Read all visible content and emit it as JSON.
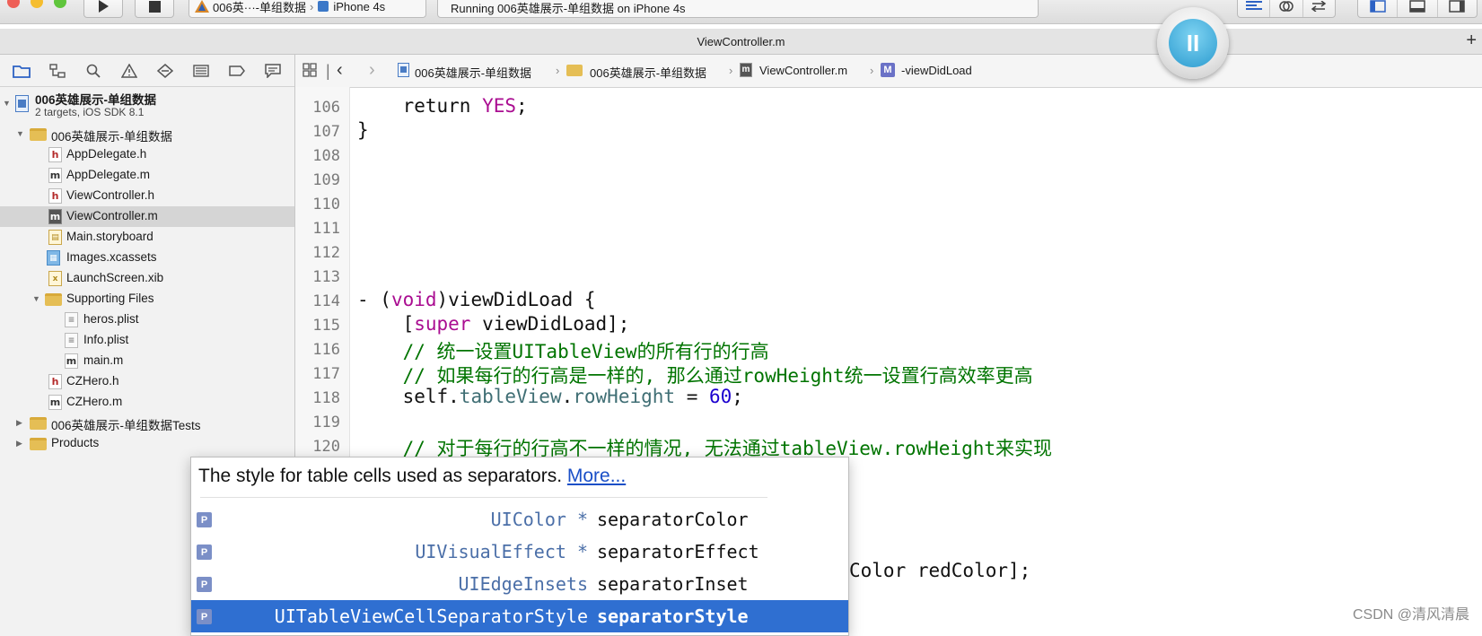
{
  "toolbar": {
    "run_icon": "play-icon",
    "stop_icon": "stop-icon",
    "scheme": "006英···-单组数据",
    "device": "iPhone 4s",
    "status": "Running 006英雄展示-单组数据 on iPhone 4s",
    "editor_modes": [
      "align-left-icon",
      "assistant-icon",
      "version-icon"
    ],
    "panel_toggles": [
      "left-panel-icon",
      "bottom-panel-icon",
      "right-panel-icon"
    ]
  },
  "tab": {
    "title": "ViewController.m",
    "add_label": "+"
  },
  "navigator": {
    "tabs": [
      "folder-icon",
      "hierarchy-icon",
      "search-icon",
      "warning-icon",
      "breakpoint-icon",
      "list-icon",
      "tag-icon",
      "comment-icon"
    ],
    "project": {
      "name": "006英雄展示-单组数据",
      "subtitle": "2 targets, iOS SDK 8.1"
    },
    "items": [
      {
        "label": "006英雄展示-单组数据",
        "kind": "folder"
      },
      {
        "label": "AppDelegate.h",
        "kind": "h"
      },
      {
        "label": "AppDelegate.m",
        "kind": "m"
      },
      {
        "label": "ViewController.h",
        "kind": "h"
      },
      {
        "label": "ViewController.m",
        "kind": "m",
        "selected": true
      },
      {
        "label": "Main.storyboard",
        "kind": "storyboard"
      },
      {
        "label": "Images.xcassets",
        "kind": "assets"
      },
      {
        "label": "LaunchScreen.xib",
        "kind": "xib"
      },
      {
        "label": "Supporting Files",
        "kind": "folder"
      },
      {
        "label": "heros.plist",
        "kind": "plist"
      },
      {
        "label": "Info.plist",
        "kind": "plist"
      },
      {
        "label": "main.m",
        "kind": "m"
      },
      {
        "label": "CZHero.h",
        "kind": "h"
      },
      {
        "label": "CZHero.m",
        "kind": "m"
      },
      {
        "label": "006英雄展示-单组数据Tests",
        "kind": "folder"
      },
      {
        "label": "Products",
        "kind": "folder"
      }
    ]
  },
  "jumpbar": {
    "crumbs": [
      "006英雄展示-单组数据",
      "006英雄展示-单组数据",
      "ViewController.m",
      "-viewDidLoad"
    ]
  },
  "editor": {
    "line_numbers": [
      "106",
      "107",
      "108",
      "109",
      "110",
      "111",
      "112",
      "113",
      "114",
      "115",
      "116",
      "117",
      "118",
      "119",
      "120"
    ],
    "lines": {
      "l106_a": "    return ",
      "l106_b": "YES",
      "l106_c": ";",
      "l107": "}",
      "l114_a": "- (",
      "l114_b": "void",
      "l114_c": ")viewDidLoad {",
      "l115_a": "    [",
      "l115_b": "super",
      "l115_c": " viewDidLoad];",
      "l116": "    // 统一设置UITableView的所有行的行高",
      "l117": "    // 如果每行的行高是一样的, 那么通过rowHeight统一设置行高效率更高",
      "l118_a": "    self.",
      "l118_b": "tableView",
      "l118_c": ".",
      "l118_d": "rowHeight",
      "l118_e": " = ",
      "l118_f": "60",
      "l118_g": ";",
      "l120": "    // 对于每行的行高不一样的情况, 无法通过tableView.rowHeight来实现",
      "hidden_tail": "Color redColor];"
    }
  },
  "autocomplete": {
    "description": "The style for table cells used as separators.",
    "more_link": "More...",
    "items": [
      {
        "badge": "P",
        "type": "UIColor *",
        "name": "separatorColor"
      },
      {
        "badge": "P",
        "type": "UIVisualEffect *",
        "name": "separatorEffect"
      },
      {
        "badge": "P",
        "type": "UIEdgeInsets",
        "name": "separatorInset"
      },
      {
        "badge": "P",
        "type": "UITableViewCellSeparatorStyle",
        "name": "separatorStyle",
        "selected": true
      }
    ]
  },
  "overlay": {
    "pause_icon": "pause-icon",
    "pause_glyph": "II"
  },
  "watermark": "CSDN @清风清晨"
}
